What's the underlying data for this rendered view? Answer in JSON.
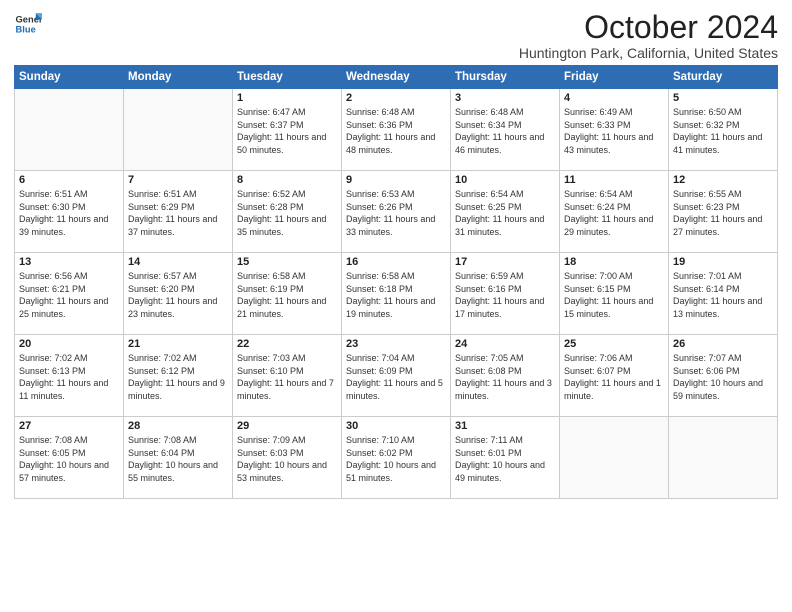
{
  "logo": {
    "line1": "General",
    "line2": "Blue"
  },
  "title": "October 2024",
  "location": "Huntington Park, California, United States",
  "days_of_week": [
    "Sunday",
    "Monday",
    "Tuesday",
    "Wednesday",
    "Thursday",
    "Friday",
    "Saturday"
  ],
  "weeks": [
    [
      {
        "day": "",
        "content": ""
      },
      {
        "day": "",
        "content": ""
      },
      {
        "day": "1",
        "content": "Sunrise: 6:47 AM\nSunset: 6:37 PM\nDaylight: 11 hours and 50 minutes."
      },
      {
        "day": "2",
        "content": "Sunrise: 6:48 AM\nSunset: 6:36 PM\nDaylight: 11 hours and 48 minutes."
      },
      {
        "day": "3",
        "content": "Sunrise: 6:48 AM\nSunset: 6:34 PM\nDaylight: 11 hours and 46 minutes."
      },
      {
        "day": "4",
        "content": "Sunrise: 6:49 AM\nSunset: 6:33 PM\nDaylight: 11 hours and 43 minutes."
      },
      {
        "day": "5",
        "content": "Sunrise: 6:50 AM\nSunset: 6:32 PM\nDaylight: 11 hours and 41 minutes."
      }
    ],
    [
      {
        "day": "6",
        "content": "Sunrise: 6:51 AM\nSunset: 6:30 PM\nDaylight: 11 hours and 39 minutes."
      },
      {
        "day": "7",
        "content": "Sunrise: 6:51 AM\nSunset: 6:29 PM\nDaylight: 11 hours and 37 minutes."
      },
      {
        "day": "8",
        "content": "Sunrise: 6:52 AM\nSunset: 6:28 PM\nDaylight: 11 hours and 35 minutes."
      },
      {
        "day": "9",
        "content": "Sunrise: 6:53 AM\nSunset: 6:26 PM\nDaylight: 11 hours and 33 minutes."
      },
      {
        "day": "10",
        "content": "Sunrise: 6:54 AM\nSunset: 6:25 PM\nDaylight: 11 hours and 31 minutes."
      },
      {
        "day": "11",
        "content": "Sunrise: 6:54 AM\nSunset: 6:24 PM\nDaylight: 11 hours and 29 minutes."
      },
      {
        "day": "12",
        "content": "Sunrise: 6:55 AM\nSunset: 6:23 PM\nDaylight: 11 hours and 27 minutes."
      }
    ],
    [
      {
        "day": "13",
        "content": "Sunrise: 6:56 AM\nSunset: 6:21 PM\nDaylight: 11 hours and 25 minutes."
      },
      {
        "day": "14",
        "content": "Sunrise: 6:57 AM\nSunset: 6:20 PM\nDaylight: 11 hours and 23 minutes."
      },
      {
        "day": "15",
        "content": "Sunrise: 6:58 AM\nSunset: 6:19 PM\nDaylight: 11 hours and 21 minutes."
      },
      {
        "day": "16",
        "content": "Sunrise: 6:58 AM\nSunset: 6:18 PM\nDaylight: 11 hours and 19 minutes."
      },
      {
        "day": "17",
        "content": "Sunrise: 6:59 AM\nSunset: 6:16 PM\nDaylight: 11 hours and 17 minutes."
      },
      {
        "day": "18",
        "content": "Sunrise: 7:00 AM\nSunset: 6:15 PM\nDaylight: 11 hours and 15 minutes."
      },
      {
        "day": "19",
        "content": "Sunrise: 7:01 AM\nSunset: 6:14 PM\nDaylight: 11 hours and 13 minutes."
      }
    ],
    [
      {
        "day": "20",
        "content": "Sunrise: 7:02 AM\nSunset: 6:13 PM\nDaylight: 11 hours and 11 minutes."
      },
      {
        "day": "21",
        "content": "Sunrise: 7:02 AM\nSunset: 6:12 PM\nDaylight: 11 hours and 9 minutes."
      },
      {
        "day": "22",
        "content": "Sunrise: 7:03 AM\nSunset: 6:10 PM\nDaylight: 11 hours and 7 minutes."
      },
      {
        "day": "23",
        "content": "Sunrise: 7:04 AM\nSunset: 6:09 PM\nDaylight: 11 hours and 5 minutes."
      },
      {
        "day": "24",
        "content": "Sunrise: 7:05 AM\nSunset: 6:08 PM\nDaylight: 11 hours and 3 minutes."
      },
      {
        "day": "25",
        "content": "Sunrise: 7:06 AM\nSunset: 6:07 PM\nDaylight: 11 hours and 1 minute."
      },
      {
        "day": "26",
        "content": "Sunrise: 7:07 AM\nSunset: 6:06 PM\nDaylight: 10 hours and 59 minutes."
      }
    ],
    [
      {
        "day": "27",
        "content": "Sunrise: 7:08 AM\nSunset: 6:05 PM\nDaylight: 10 hours and 57 minutes."
      },
      {
        "day": "28",
        "content": "Sunrise: 7:08 AM\nSunset: 6:04 PM\nDaylight: 10 hours and 55 minutes."
      },
      {
        "day": "29",
        "content": "Sunrise: 7:09 AM\nSunset: 6:03 PM\nDaylight: 10 hours and 53 minutes."
      },
      {
        "day": "30",
        "content": "Sunrise: 7:10 AM\nSunset: 6:02 PM\nDaylight: 10 hours and 51 minutes."
      },
      {
        "day": "31",
        "content": "Sunrise: 7:11 AM\nSunset: 6:01 PM\nDaylight: 10 hours and 49 minutes."
      },
      {
        "day": "",
        "content": ""
      },
      {
        "day": "",
        "content": ""
      }
    ]
  ]
}
